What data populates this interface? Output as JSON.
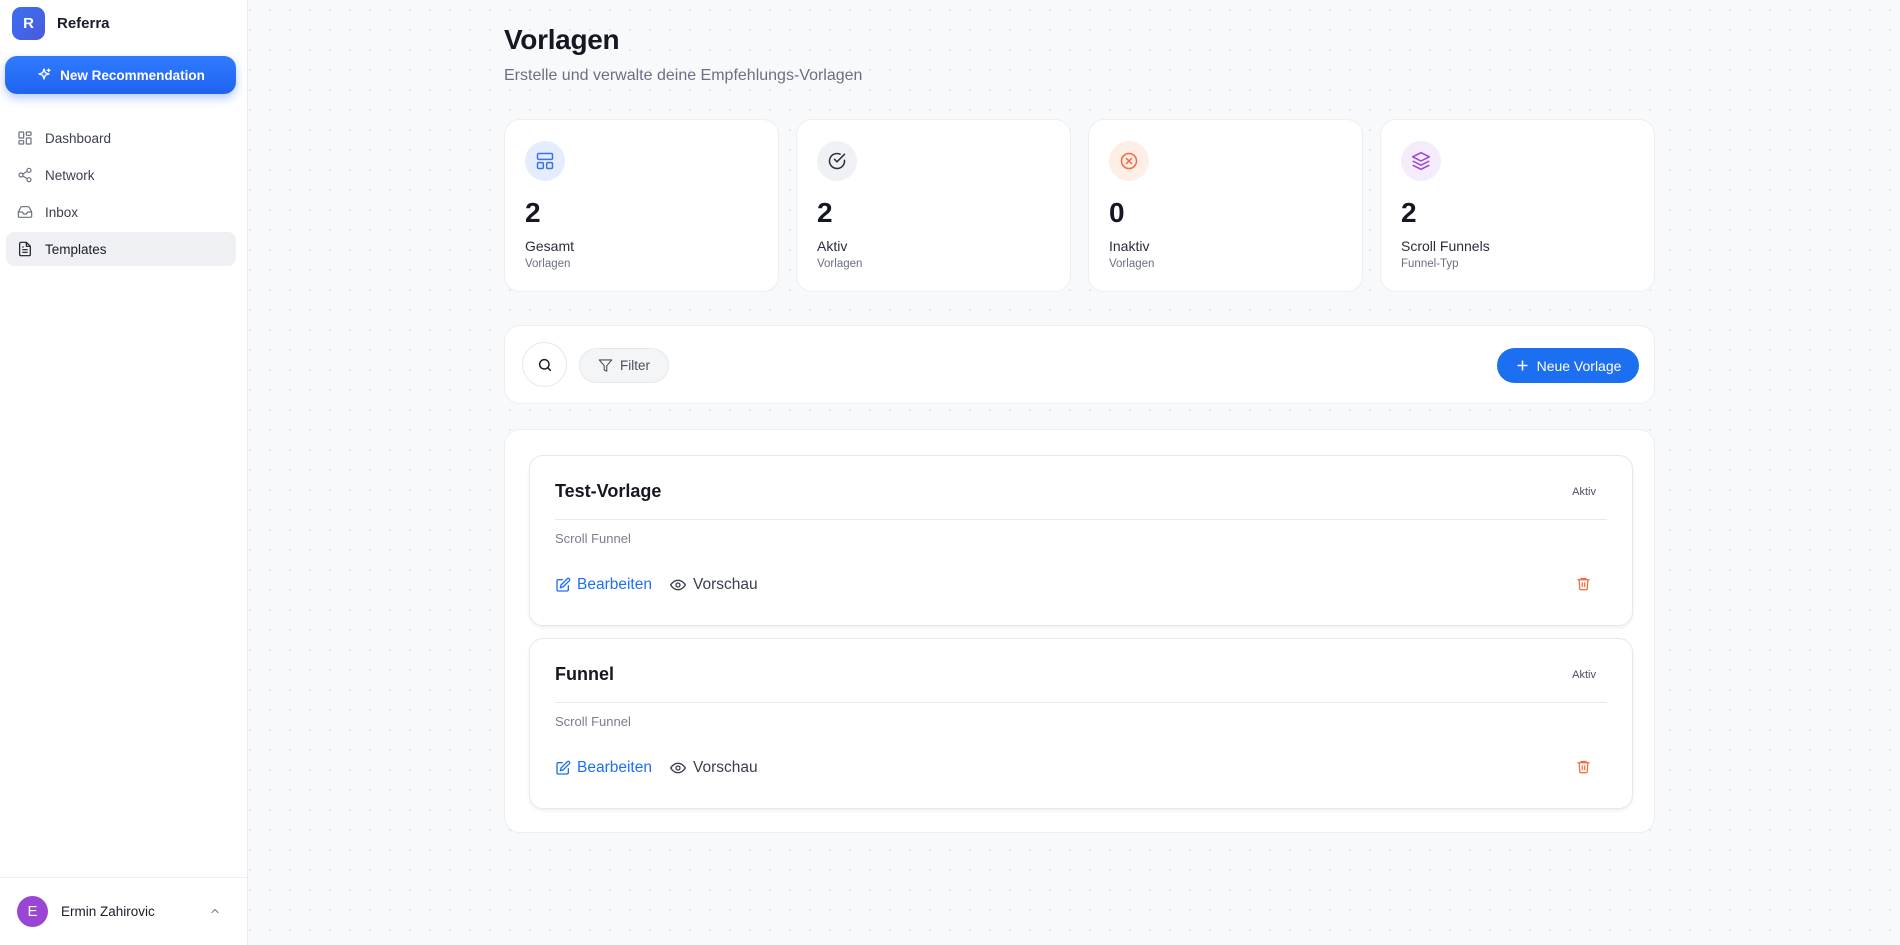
{
  "app": {
    "logo_letter": "R",
    "name": "Referra",
    "new_recommendation_label": "New Recommendation"
  },
  "sidebar": {
    "items": [
      {
        "label": "Dashboard",
        "icon": "dashboard-icon",
        "active": false
      },
      {
        "label": "Network",
        "icon": "network-icon",
        "active": false
      },
      {
        "label": "Inbox",
        "icon": "inbox-icon",
        "active": false
      },
      {
        "label": "Templates",
        "icon": "document-icon",
        "active": true
      }
    ]
  },
  "user": {
    "initial": "E",
    "name": "Ermin Zahirovic",
    "avatar_color": "#9b45d4"
  },
  "page": {
    "title": "Vorlagen",
    "subtitle": "Erstelle und verwalte deine Empfehlungs-Vorlagen"
  },
  "stats": [
    {
      "value": "2",
      "label": "Gesamt",
      "sub": "Vorlagen",
      "icon": "layout-icon",
      "color": "#3b6ff5"
    },
    {
      "value": "2",
      "label": "Aktiv",
      "sub": "Vorlagen",
      "icon": "check-circle-icon",
      "color": "#2a2e3a"
    },
    {
      "value": "0",
      "label": "Inaktiv",
      "sub": "Vorlagen",
      "icon": "x-circle-icon",
      "color": "#f26a3d"
    },
    {
      "value": "2",
      "label": "Scroll Funnels",
      "sub": "Funnel-Typ",
      "icon": "layers-icon",
      "color": "#9b45d4"
    }
  ],
  "toolbar": {
    "filter_label": "Filter",
    "new_template_label": "Neue Vorlage"
  },
  "templates": [
    {
      "name": "Test-Vorlage",
      "status": "Aktiv",
      "type": "Scroll Funnel",
      "edit_label": "Bearbeiten",
      "preview_label": "Vorschau"
    },
    {
      "name": "Funnel",
      "status": "Aktiv",
      "type": "Scroll Funnel",
      "edit_label": "Bearbeiten",
      "preview_label": "Vorschau"
    }
  ],
  "colors": {
    "accent": "#1d6ff2",
    "danger": "#f26a3d"
  }
}
